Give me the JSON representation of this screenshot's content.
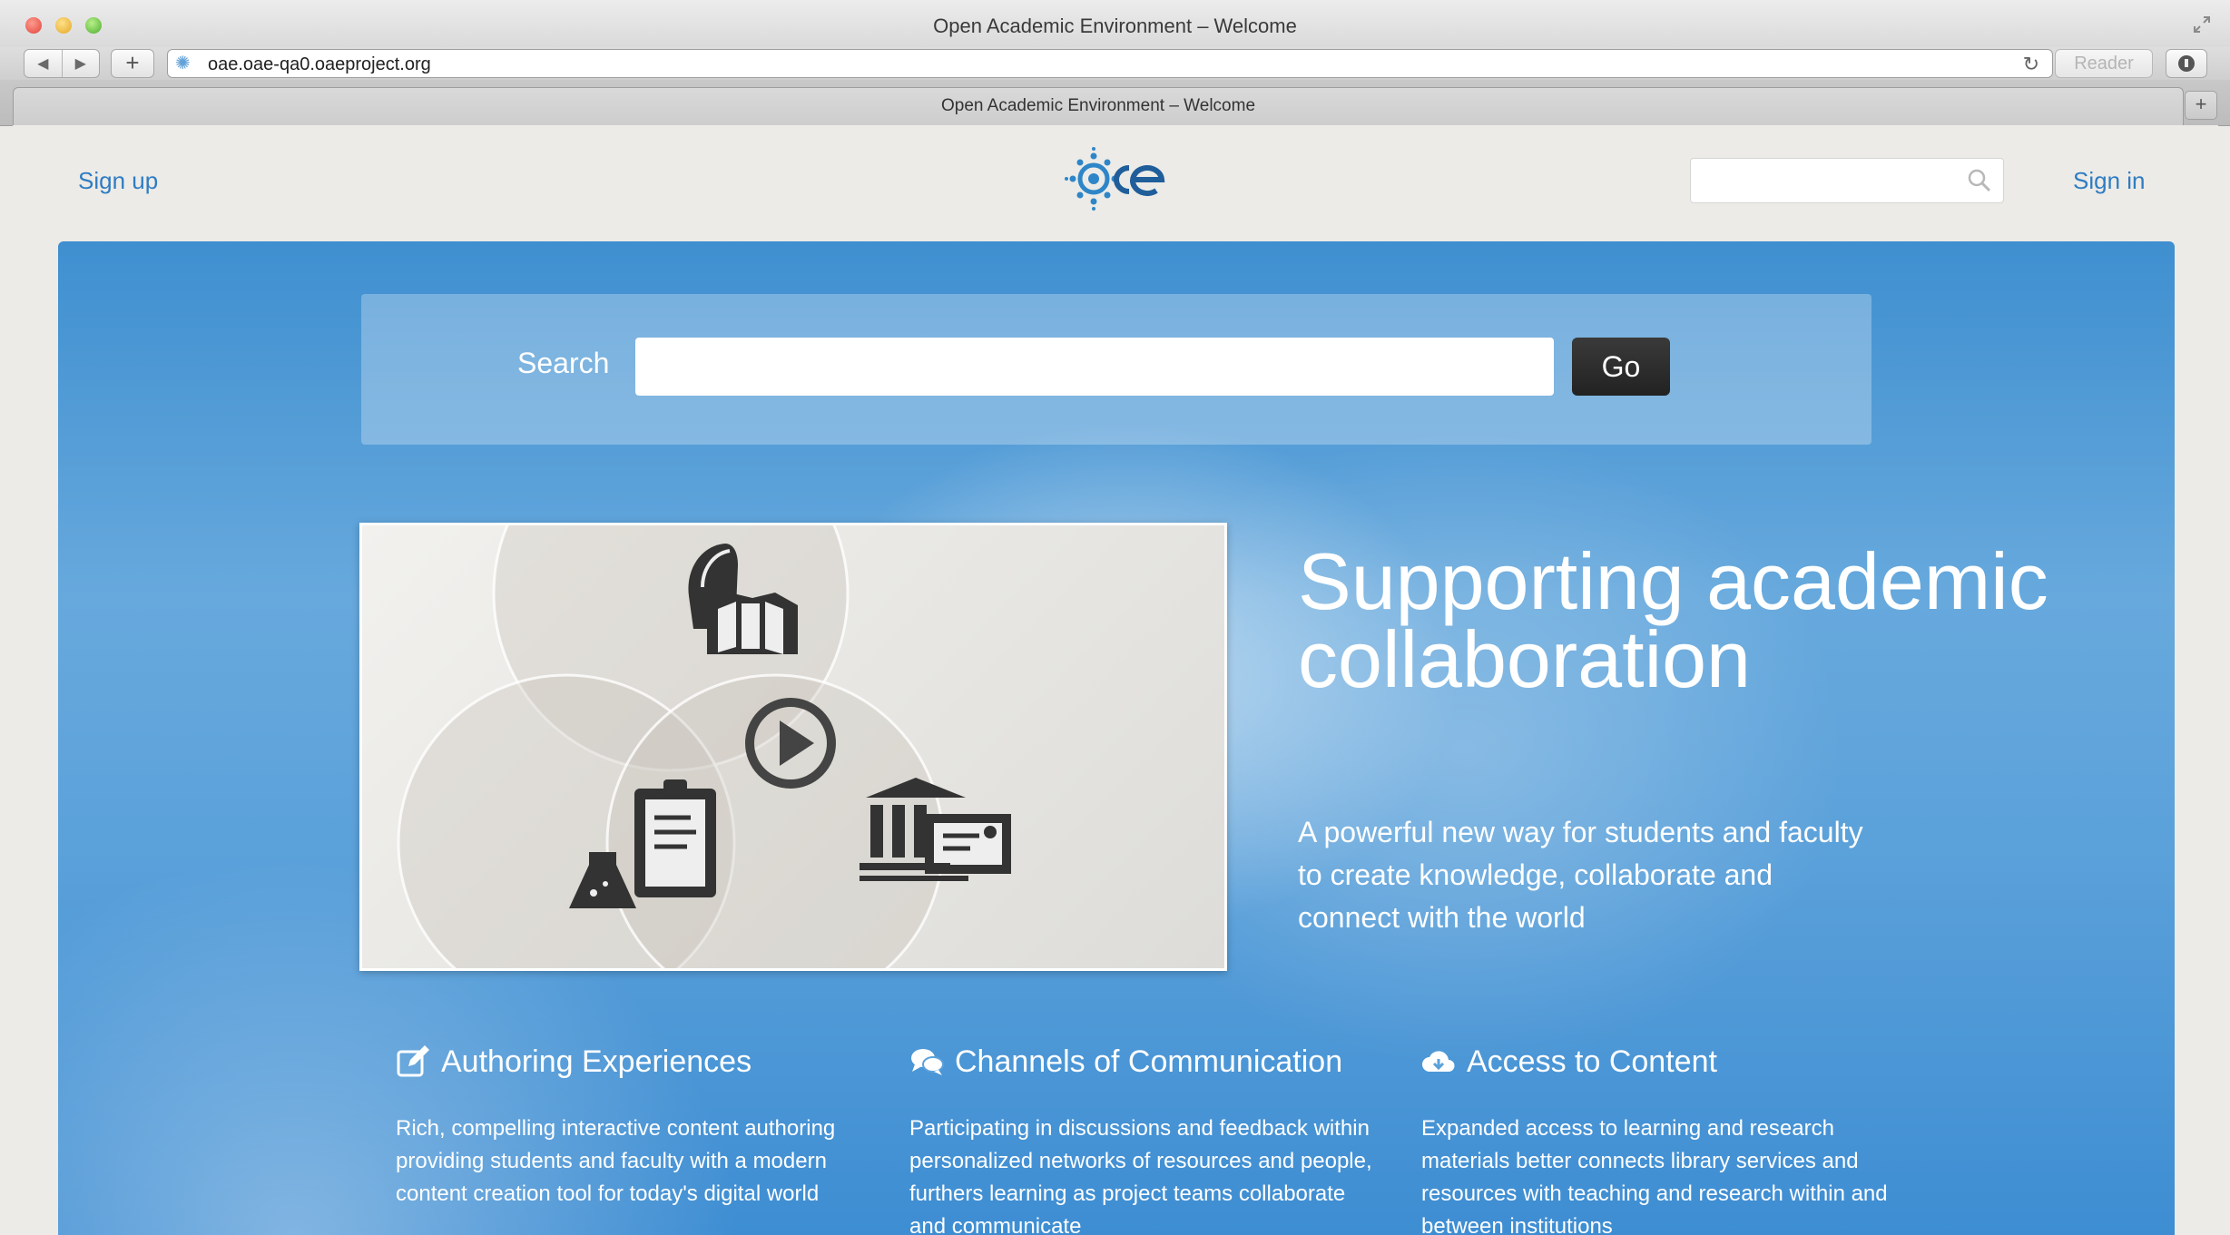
{
  "window": {
    "title": "Open Academic Environment – Welcome"
  },
  "toolbar": {
    "url": "oae.oae-qa0.oaeproject.org",
    "reader_label": "Reader",
    "new_tab_label": "+"
  },
  "tabs": [
    {
      "label": "Open Academic Environment – Welcome",
      "active": true
    }
  ],
  "header": {
    "signup_label": "Sign up",
    "signin_label": "Sign in",
    "search_placeholder": "",
    "logo_icon": "oae-logo"
  },
  "hero": {
    "search_label": "Search",
    "search_value": "",
    "go_label": "Go",
    "headline": "Supporting academic collaboration",
    "tagline": "A powerful new way for students and faculty to create knowledge, collaborate and connect with the world",
    "video_icons": [
      "backpack-book-icon",
      "play-icon",
      "lab-clipboard-icon",
      "lecture-hall-icon"
    ]
  },
  "features": [
    {
      "icon": "edit-icon",
      "title": "Authoring Experiences",
      "text": "Rich, compelling interactive content authoring providing students and faculty with a modern content creation tool for today's digital world"
    },
    {
      "icon": "chat-icon",
      "title": "Channels of Communication",
      "text": "Participating in discussions and feedback within personalized networks of resources and people, furthers learning as project teams collaborate and communicate"
    },
    {
      "icon": "cloud-download-icon",
      "title": "Access to Content",
      "text": "Expanded access to learning and research materials better connects library services and resources with teaching and research within and between institutions"
    }
  ],
  "colors": {
    "link": "#2f7cc2",
    "hero_blue": "#5ba1da",
    "go_button": "#2a2a2a"
  }
}
